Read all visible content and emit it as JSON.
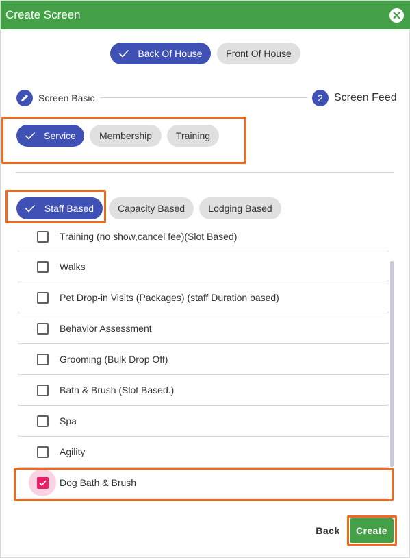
{
  "header": {
    "title": "Create Screen"
  },
  "area_tabs": [
    {
      "label": "Back Of House",
      "selected": true
    },
    {
      "label": "Front Of House",
      "selected": false
    }
  ],
  "stepper": [
    {
      "number": "1",
      "icon": "pencil-icon",
      "label": "Screen Basic"
    },
    {
      "number": "2",
      "label": "Screen Feed"
    }
  ],
  "categories": [
    {
      "label": "Service",
      "selected": true
    },
    {
      "label": "Membership",
      "selected": false
    },
    {
      "label": "Training",
      "selected": false
    }
  ],
  "service_types": [
    {
      "label": "Staff Based",
      "selected": true
    },
    {
      "label": "Capacity Based",
      "selected": false
    },
    {
      "label": "Lodging Based",
      "selected": false
    }
  ],
  "services": [
    {
      "label": "Training (no show,cancel fee)(Slot Based)",
      "checked": false
    },
    {
      "label": "Walks",
      "checked": false
    },
    {
      "label": "Pet Drop-in Visits (Packages) (staff Duration based)",
      "checked": false
    },
    {
      "label": "Behavior Assessment",
      "checked": false
    },
    {
      "label": "Grooming (Bulk Drop Off)",
      "checked": false
    },
    {
      "label": "Bath & Brush (Slot Based.)",
      "checked": false
    },
    {
      "label": "Spa",
      "checked": false
    },
    {
      "label": "Agility",
      "checked": false
    },
    {
      "label": "Dog Bath & Brush",
      "checked": true
    }
  ],
  "footer": {
    "back_label": "Back",
    "create_label": "Create"
  },
  "colors": {
    "header": "#43a047",
    "primary": "#3f51b5",
    "checkbox": "#e91e63",
    "annotation": "#f06a1d"
  }
}
